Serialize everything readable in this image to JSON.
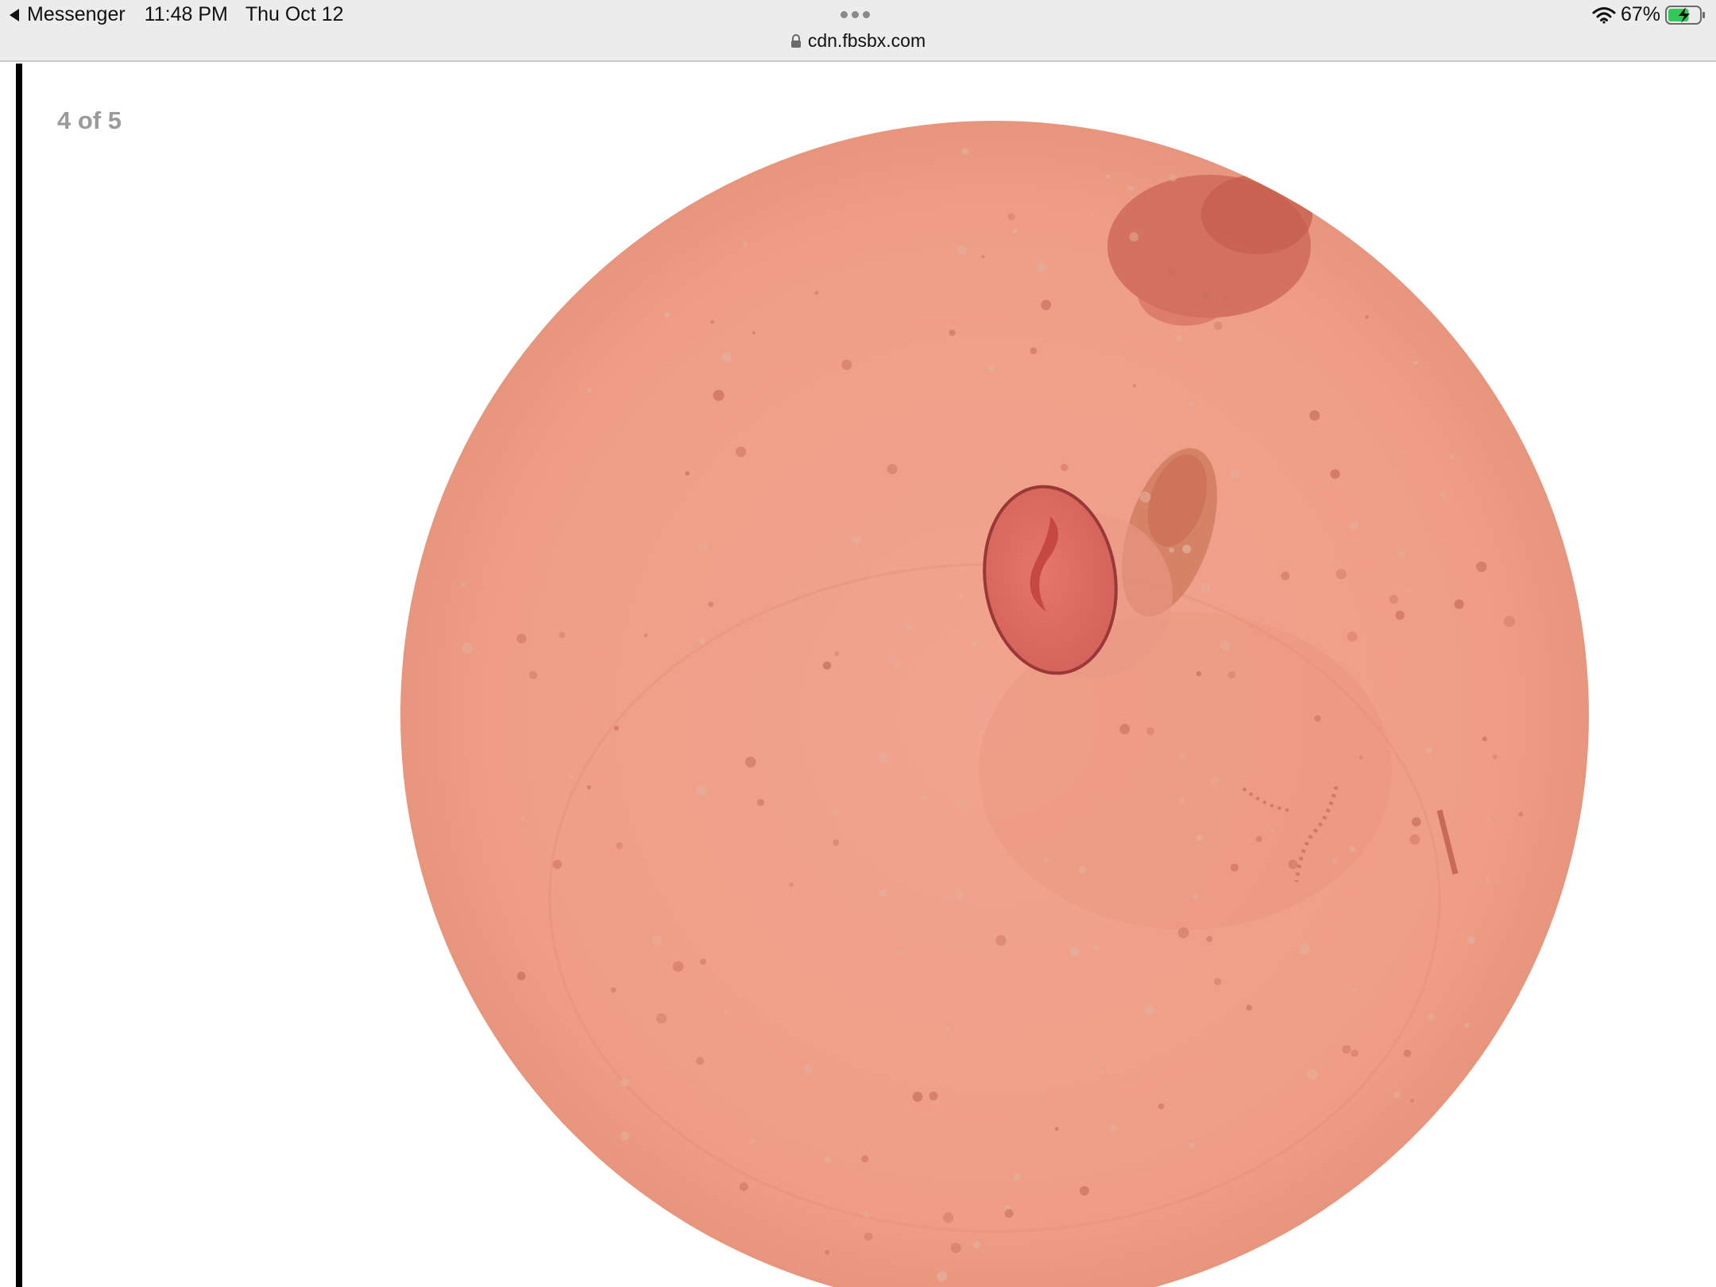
{
  "status_bar": {
    "back_app": "Messenger",
    "time": "11:48 PM",
    "date": "Thu Oct 12",
    "battery_percent": "67%",
    "battery_level": 0.67,
    "url": "cdn.fbsbx.com",
    "icons": {
      "back": "back-triangle-icon",
      "more": "more-dots-icon",
      "lock": "lock-icon",
      "wifi": "wifi-icon",
      "battery": "battery-charging-icon"
    },
    "colors": {
      "battery_fill": "#35c759"
    }
  },
  "viewer": {
    "page_counter": "4 of 5"
  },
  "image": {
    "content": "microscope-field",
    "colors": {
      "field": "#f0a089",
      "egg": "#d9685f",
      "egg_outline": "#a03a3a",
      "cluster": "#c85a4a"
    }
  }
}
